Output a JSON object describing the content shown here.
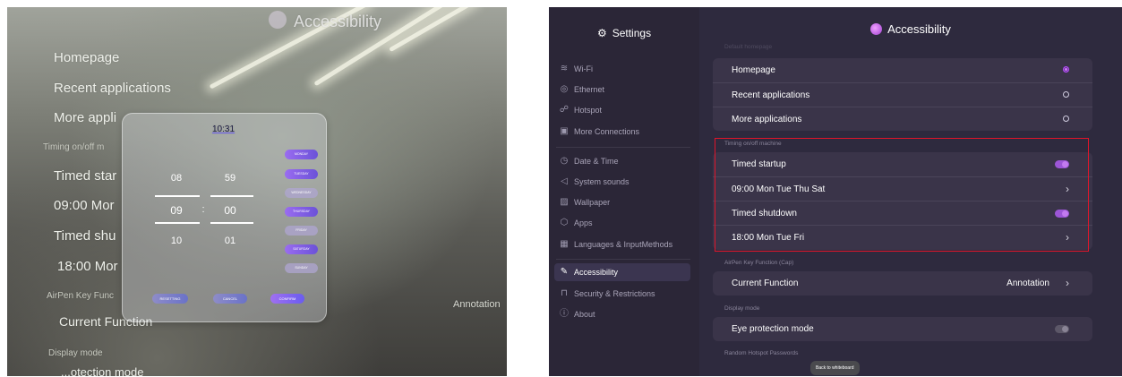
{
  "photo": {
    "title": "Accessibility",
    "items": {
      "homepage": "Homepage",
      "recent": "Recent applications",
      "more": "More appli",
      "timing": "Timing on/off m",
      "startup": "Timed star",
      "startup_sched": "09:00  Mor",
      "shutdown": "Timed shu",
      "shutdown_sched": "18:00  Mor",
      "airpen": "AirPen Key Func",
      "current": "Current Function",
      "annotation": "Annotation",
      "display": "Display mode",
      "eye": "...otection mode"
    },
    "dialog": {
      "time": "10:31",
      "hour_prev": "08",
      "hour_sel": "09",
      "hour_next": "10",
      "colon": ":",
      "min_prev": "59",
      "min_sel": "00",
      "min_next": "01",
      "days": [
        "MONDAY",
        "TUESDAY",
        "WEDNESDAY",
        "THURSDAY",
        "FRIDAY",
        "SATURDAY",
        "SUNDAY"
      ],
      "reset": "RESETTING",
      "cancel": "CANCEL",
      "confirm": "CONFIRM"
    }
  },
  "settings": {
    "title": "Settings",
    "sidebar": [
      {
        "label": "Wi-Fi",
        "icon": "wifi-icon",
        "glyph": "≋"
      },
      {
        "label": "Ethernet",
        "icon": "ethernet-icon",
        "glyph": "◎"
      },
      {
        "label": "Hotspot",
        "icon": "hotspot-icon",
        "glyph": "☍"
      },
      {
        "label": "More Connections",
        "icon": "connections-icon",
        "glyph": "▣"
      },
      {
        "label": "Date & Time",
        "icon": "clock-icon",
        "glyph": "◷"
      },
      {
        "label": "System sounds",
        "icon": "speaker-icon",
        "glyph": "◁"
      },
      {
        "label": "Wallpaper",
        "icon": "wallpaper-icon",
        "glyph": "▨"
      },
      {
        "label": "Apps",
        "icon": "apps-icon",
        "glyph": "⬡"
      },
      {
        "label": "Languages & InputMethods",
        "icon": "keyboard-icon",
        "glyph": "▦"
      },
      {
        "label": "Accessibility",
        "icon": "accessibility-icon",
        "glyph": "✎"
      },
      {
        "label": "Security & Restrictions",
        "icon": "lock-icon",
        "glyph": "⊓"
      },
      {
        "label": "About",
        "icon": "info-icon",
        "glyph": "ⓘ"
      }
    ],
    "header": "Accessibility",
    "partial_section": "Default homepage",
    "startup_rows": {
      "homepage": "Homepage",
      "recent": "Recent applications",
      "more": "More applications"
    },
    "timing_label": "Timing on/off machine",
    "timed_startup": "Timed startup",
    "startup_schedule": "09:00  Mon Tue Thu Sat",
    "timed_shutdown": "Timed shutdown",
    "shutdown_schedule": "18:00  Mon Tue Fri",
    "airpen_label": "AirPen Key Function (Cap)",
    "current_function": "Current Function",
    "current_function_value": "Annotation",
    "display_label": "Display mode",
    "eye_protection": "Eye protection mode",
    "hotspot_pw_label": "Random Hotspot Passwords",
    "tooltip": "Back to whiteboard",
    "accent": "#a64ce0",
    "highlight": "#e0152a"
  }
}
